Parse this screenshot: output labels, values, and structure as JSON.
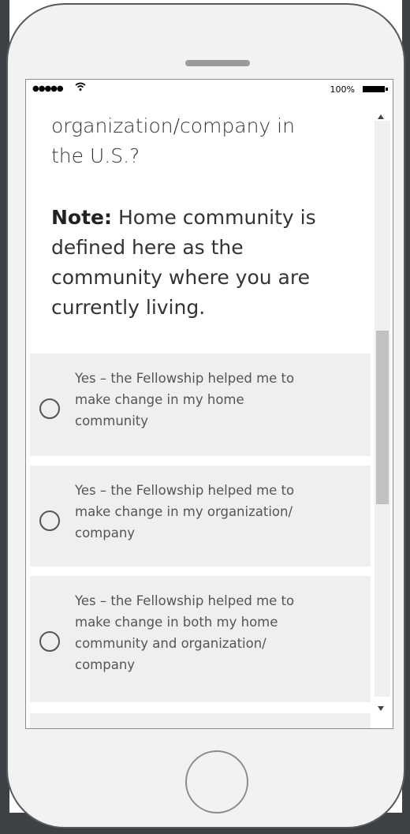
{
  "status_bar": {
    "signal": "●●●●●",
    "wifi_icon": "wifi-icon",
    "battery_percent": "100%"
  },
  "question": {
    "lines": [
      "organization/company in",
      "the U.S.?"
    ]
  },
  "note": {
    "label": "Note:",
    "lines": [
      "Home community is",
      "defined here as the",
      "community where you are",
      "currently living."
    ]
  },
  "options": [
    {
      "lines": [
        "Yes – the Fellowship helped me to",
        "make change in my home",
        "community"
      ],
      "selected": false
    },
    {
      "lines": [
        "Yes – the Fellowship helped me to",
        "make change in my organization/",
        "company"
      ],
      "selected": false
    },
    {
      "lines": [
        "Yes – the Fellowship helped me to",
        "make change in both my home",
        "community and organization/",
        "company"
      ],
      "selected": false
    }
  ],
  "colors": {
    "option_bg": "#efefef",
    "text": "#333333",
    "option_text": "#555555",
    "scroll_thumb": "#c1c1c1"
  }
}
